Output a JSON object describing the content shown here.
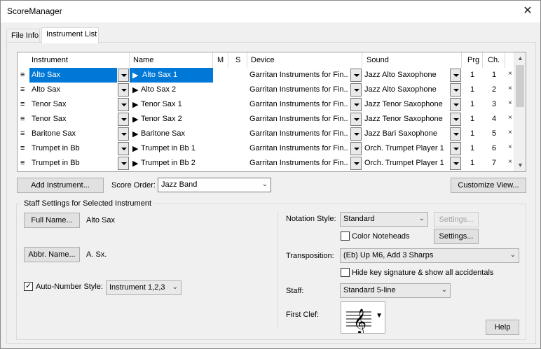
{
  "window": {
    "title": "ScoreManager"
  },
  "tabs": [
    {
      "label": "File Info",
      "active": false
    },
    {
      "label": "Instrument List",
      "active": true
    }
  ],
  "grid": {
    "columns": [
      "Instrument",
      "Name",
      "M",
      "S",
      "Device",
      "Sound",
      "Prg",
      "Ch."
    ],
    "rows": [
      {
        "instrument": "Alto Sax",
        "name": "Alto Sax 1",
        "device": "Garritan Instruments for Fin...",
        "sound": "Jazz Alto Saxophone",
        "prg": "1",
        "ch": "1",
        "selected": true
      },
      {
        "instrument": "Alto Sax",
        "name": "Alto Sax 2",
        "device": "Garritan Instruments for Fin...",
        "sound": "Jazz Alto Saxophone",
        "prg": "1",
        "ch": "2",
        "selected": false
      },
      {
        "instrument": "Tenor Sax",
        "name": "Tenor Sax 1",
        "device": "Garritan Instruments for Fin...",
        "sound": "Jazz Tenor Saxophone",
        "prg": "1",
        "ch": "3",
        "selected": false
      },
      {
        "instrument": "Tenor Sax",
        "name": "Tenor Sax 2",
        "device": "Garritan Instruments for Fin...",
        "sound": "Jazz Tenor Saxophone",
        "prg": "1",
        "ch": "4",
        "selected": false
      },
      {
        "instrument": "Baritone Sax",
        "name": "Baritone Sax",
        "device": "Garritan Instruments for Fin...",
        "sound": "Jazz Bari Saxophone",
        "prg": "1",
        "ch": "5",
        "selected": false
      },
      {
        "instrument": "Trumpet in Bb",
        "name": "Trumpet in Bb 1",
        "device": "Garritan Instruments for Fin...",
        "sound": "Orch. Trumpet Player 1",
        "prg": "1",
        "ch": "6",
        "selected": false
      },
      {
        "instrument": "Trumpet in Bb",
        "name": "Trumpet in Bb 2",
        "device": "Garritan Instruments for Fin...",
        "sound": "Orch. Trumpet Player 1",
        "prg": "1",
        "ch": "7",
        "selected": false
      }
    ],
    "row_handle": "≡",
    "name_prefix": "▶",
    "remove_glyph": "×"
  },
  "toolbar": {
    "add_instrument": "Add Instrument...",
    "score_order_label": "Score Order:",
    "score_order_value": "Jazz Band",
    "customize_view": "Customize View..."
  },
  "staff_settings": {
    "title": "Staff Settings for Selected Instrument",
    "full_name_button": "Full Name...",
    "full_name_value": "Alto Sax",
    "abbr_name_button": "Abbr. Name...",
    "abbr_name_value": "A. Sx.",
    "auto_number_label": "Auto-Number Style:",
    "auto_number_checked": true,
    "auto_number_value": "Instrument 1,2,3",
    "notation_style_label": "Notation Style:",
    "notation_style_value": "Standard",
    "settings_disabled": "Settings...",
    "color_noteheads": "Color Noteheads",
    "color_noteheads_checked": false,
    "settings": "Settings...",
    "transposition_label": "Transposition:",
    "transposition_value": "(Eb) Up M6, Add 3 Sharps",
    "hide_key_sig": "Hide key signature & show all accidentals",
    "hide_key_sig_checked": false,
    "staff_label": "Staff:",
    "staff_value": "Standard 5-line",
    "first_clef_label": "First Clef:",
    "clef_icon": "treble-clef",
    "help": "Help"
  }
}
